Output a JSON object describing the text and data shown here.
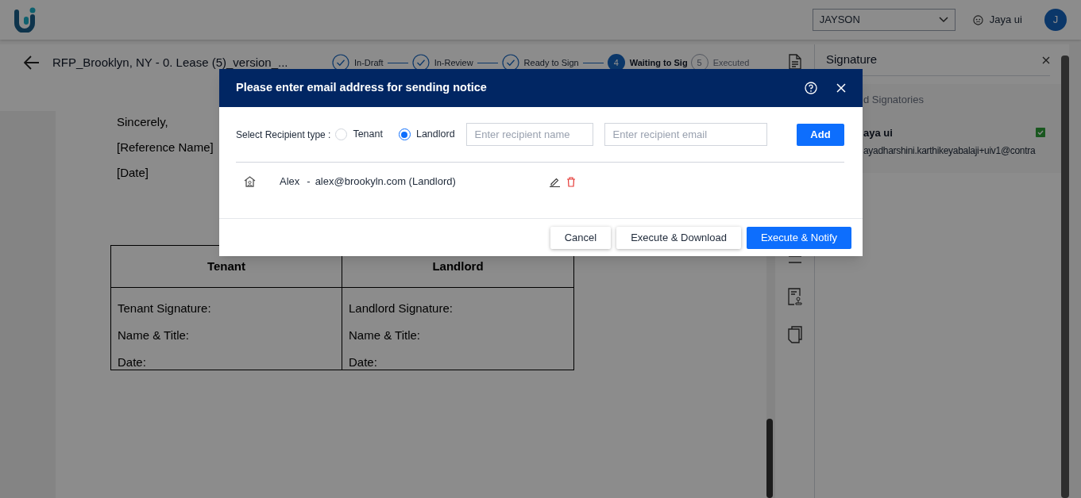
{
  "app_bar": {
    "user_select": {
      "value": "JAYSON"
    },
    "user_name": "Jaya ui",
    "avatar_initial": "J"
  },
  "document_header": {
    "title": "RFP_Brooklyn, NY - 0. Lease (5)_version_...",
    "steps": [
      {
        "label": "In-Draft",
        "kind": "done"
      },
      {
        "label": "In-Review",
        "kind": "done"
      },
      {
        "label": "Ready to Sign",
        "kind": "done"
      },
      {
        "number": "4",
        "label": "Waiting to Sig",
        "kind": "current"
      },
      {
        "number": "5",
        "label": "Executed",
        "kind": "pending"
      }
    ]
  },
  "document": {
    "lines": [
      "Sincerely,",
      "[Reference Name]",
      "[Date]"
    ],
    "signature_table": {
      "columns": [
        "Tenant",
        "Landlord"
      ],
      "cells": [
        [
          "Tenant Signature:",
          "Name & Title:",
          "Date:"
        ],
        [
          "Landlord Signature:",
          "Name & Title:",
          "Date:"
        ]
      ]
    }
  },
  "signature_panel": {
    "title": "Signature",
    "section_label": "d Signatories",
    "signatories": [
      {
        "name": "aya ui",
        "email": "ayadharshini.karthikeyabalaji+uiv1@contra",
        "signed": true
      }
    ]
  },
  "dialog": {
    "title": "Please enter email address for sending notice",
    "recipient_type_label": "Select Recipient type :",
    "recipient_types": [
      {
        "label": "Tenant",
        "selected": false
      },
      {
        "label": "Landlord",
        "selected": true
      }
    ],
    "name_field": {
      "placeholder": "Enter recipient name"
    },
    "email_field": {
      "placeholder": "Enter recipient email"
    },
    "add_button": "Add",
    "recipients": [
      {
        "name": "Alex",
        "separator": "-",
        "detail": "alex@brookyln.com (Landlord)"
      }
    ],
    "buttons": [
      {
        "label": "Cancel",
        "kind": "secondary"
      },
      {
        "label": "Execute & Download",
        "kind": "secondary"
      },
      {
        "label": "Execute & Notify",
        "kind": "primary"
      }
    ]
  }
}
